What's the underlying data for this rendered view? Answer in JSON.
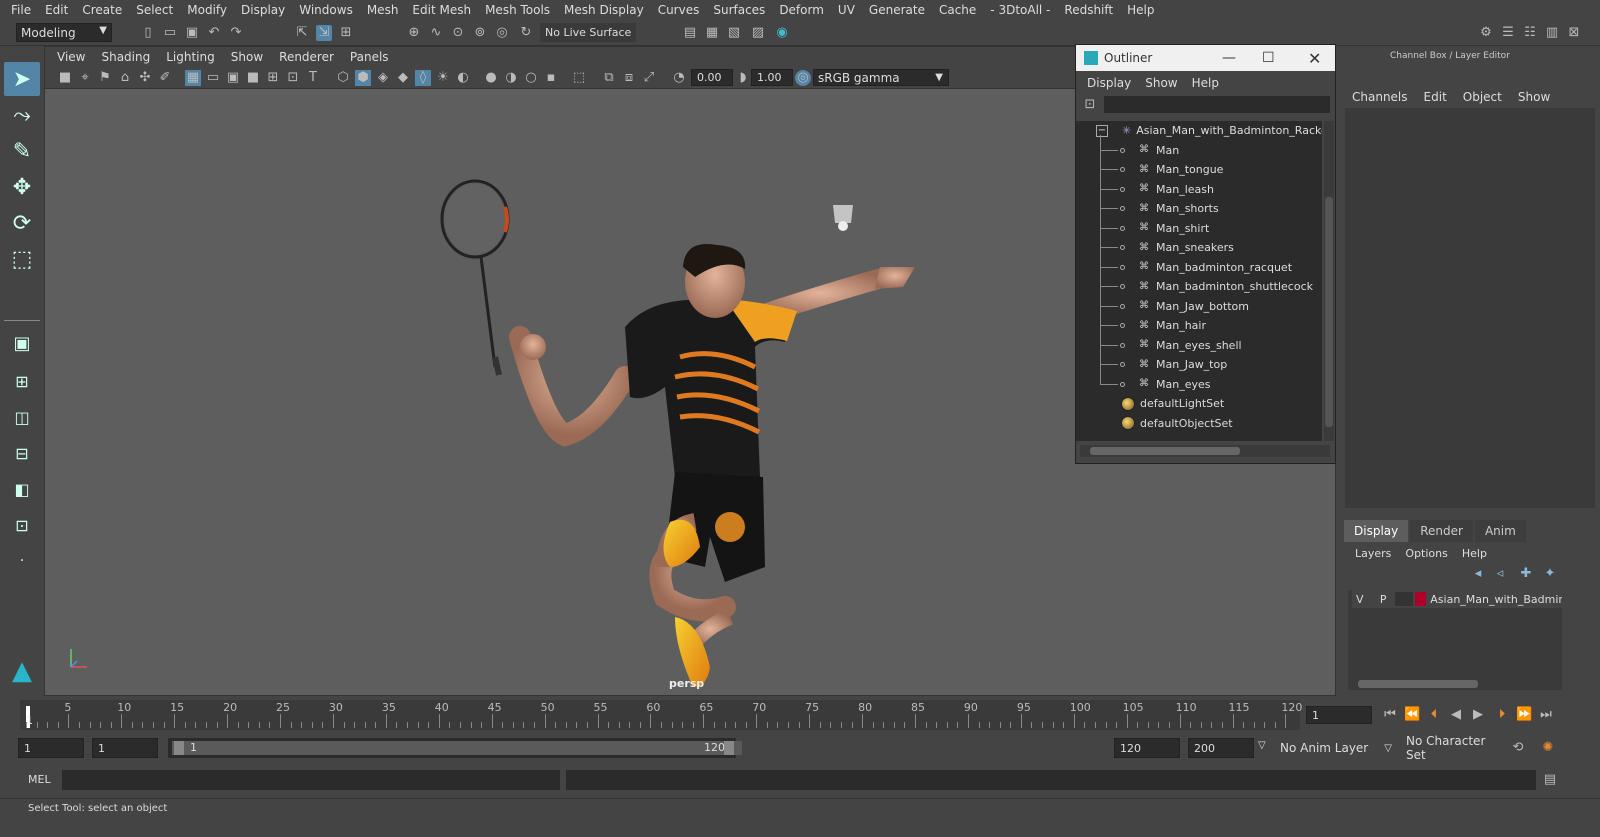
{
  "menubar": [
    "File",
    "Edit",
    "Create",
    "Select",
    "Modify",
    "Display",
    "Windows",
    "Mesh",
    "Edit Mesh",
    "Mesh Tools",
    "Mesh Display",
    "Curves",
    "Surfaces",
    "Deform",
    "UV",
    "Generate",
    "Cache",
    "- 3DtoAll -",
    "Redshift",
    "Help"
  ],
  "shelf": {
    "mode": "Modeling",
    "live_surface": "No Live Surface"
  },
  "viewport": {
    "menus": [
      "View",
      "Shading",
      "Lighting",
      "Show",
      "Renderer",
      "Panels"
    ],
    "exposure": "0.00",
    "gamma": "1.00",
    "colorspace": "sRGB gamma",
    "camera_label": "persp"
  },
  "outliner": {
    "title": "Outliner",
    "menus": [
      "Display",
      "Show",
      "Help"
    ],
    "root": "Asian_Man_with_Badminton_Racket",
    "children": [
      "Man",
      "Man_tongue",
      "Man_leash",
      "Man_shorts",
      "Man_shirt",
      "Man_sneakers",
      "Man_badminton_racquet",
      "Man_badminton_shuttlecock",
      "Man_Jaw_bottom",
      "Man_hair",
      "Man_eyes_shell",
      "Man_Jaw_top",
      "Man_eyes"
    ],
    "sets": [
      "defaultLightSet",
      "defaultObjectSet"
    ]
  },
  "channelbox": {
    "title": "Channel Box / Layer Editor",
    "menus": [
      "Channels",
      "Edit",
      "Object",
      "Show"
    ],
    "tabs": [
      "Display",
      "Render",
      "Anim"
    ],
    "layer_menus": [
      "Layers",
      "Options",
      "Help"
    ],
    "layer": {
      "v": "V",
      "p": "P",
      "name": "Asian_Man_with_Badmin",
      "color": "#b0002a"
    }
  },
  "timeline": {
    "ticks": [
      "5",
      "10",
      "15",
      "20",
      "25",
      "30",
      "35",
      "40",
      "45",
      "50",
      "55",
      "60",
      "65",
      "70",
      "75",
      "80",
      "85",
      "90",
      "95",
      "100",
      "105",
      "110",
      "115",
      "120"
    ],
    "first_tick": "1",
    "current_frame": "1"
  },
  "range": {
    "start": "1",
    "start2": "1",
    "slider_start": "1",
    "slider_end": "120",
    "end": "120",
    "end2": "200",
    "anim_layer": "No Anim Layer",
    "char_set": "No Character Set"
  },
  "cmd": {
    "label": "MEL"
  },
  "help": {
    "text": "Select Tool: select an object"
  }
}
